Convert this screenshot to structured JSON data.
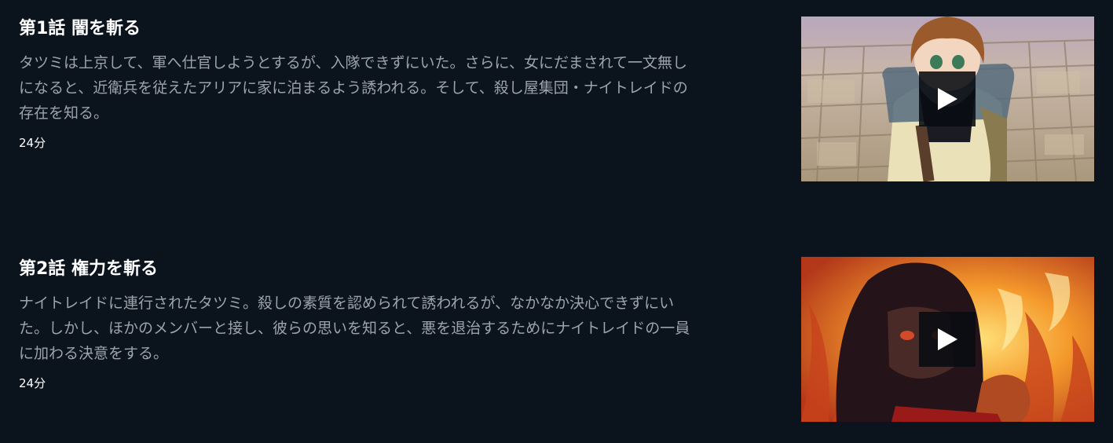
{
  "episodes": [
    {
      "title": "第1話 闇を斬る",
      "description_lines": [
        "タツミは上京して、軍へ仕官しようとするが、入隊できずにいた。さらに、女にだまされて一文無し",
        "になると、近衛兵を従えたアリアに家に泊まるよう誘われる。そして、殺し屋集団・ナイトレイドの",
        "存在を知る。"
      ],
      "duration": "24分",
      "thumbnail_icon": "play-icon"
    },
    {
      "title": "第2話 権力を斬る",
      "description_lines": [
        "ナイトレイドに連行されたタツミ。殺しの素質を認められて誘われるが、なかなか決心できずにい",
        "た。しかし、ほかのメンバーと接し、彼らの思いを知ると、悪を退治するためにナイトレイドの一員",
        "に加わる決意をする。"
      ],
      "duration": "24分",
      "thumbnail_icon": "play-icon"
    }
  ],
  "colors": {
    "background": "#0b131d",
    "title": "#ffffff",
    "description": "#9da3aa"
  }
}
